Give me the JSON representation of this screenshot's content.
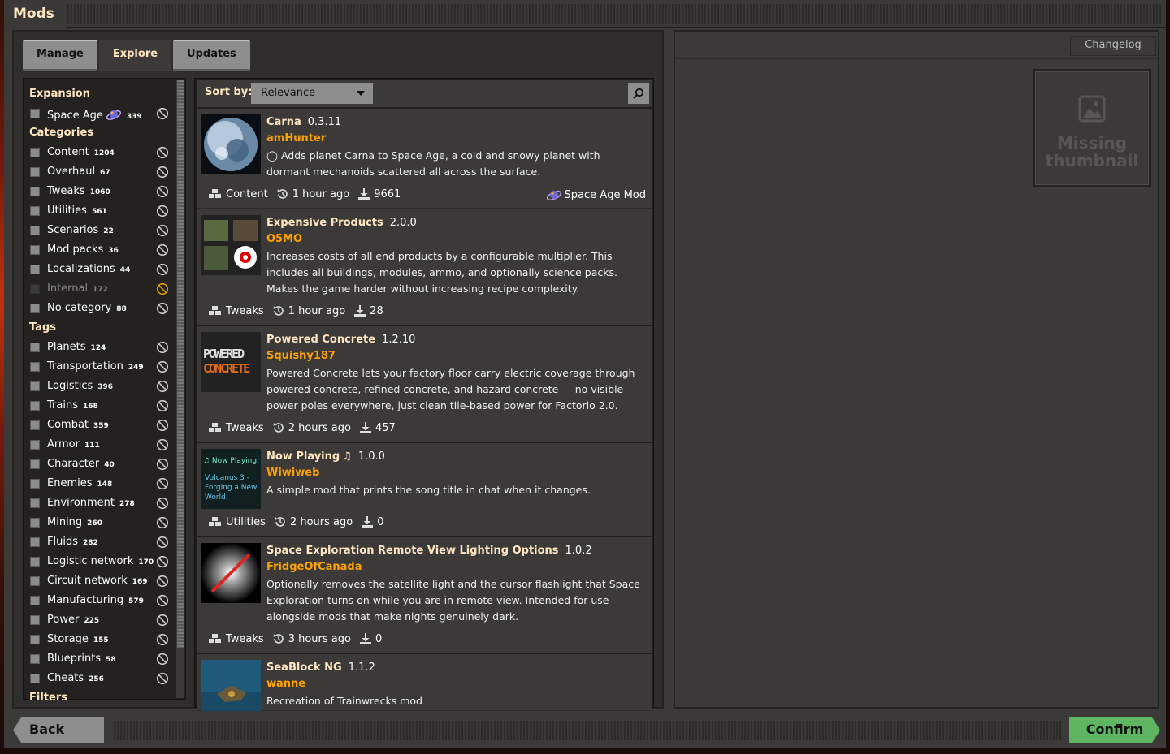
{
  "window": {
    "title": "Mods"
  },
  "tabs": [
    {
      "label": "Manage"
    },
    {
      "label": "Explore"
    },
    {
      "label": "Updates"
    }
  ],
  "filters": {
    "expansion_heading": "Expansion",
    "expansion": [
      {
        "label": "Space Age",
        "count": "339"
      }
    ],
    "categories_heading": "Categories",
    "categories": [
      {
        "label": "Content",
        "count": "1204"
      },
      {
        "label": "Overhaul",
        "count": "67"
      },
      {
        "label": "Tweaks",
        "count": "1060"
      },
      {
        "label": "Utilities",
        "count": "561"
      },
      {
        "label": "Scenarios",
        "count": "22"
      },
      {
        "label": "Mod packs",
        "count": "36"
      },
      {
        "label": "Localizations",
        "count": "44"
      },
      {
        "label": "Internal",
        "count": "172"
      },
      {
        "label": "No category",
        "count": "88"
      }
    ],
    "tags_heading": "Tags",
    "tags": [
      {
        "label": "Planets",
        "count": "124"
      },
      {
        "label": "Transportation",
        "count": "249"
      },
      {
        "label": "Logistics",
        "count": "396"
      },
      {
        "label": "Trains",
        "count": "168"
      },
      {
        "label": "Combat",
        "count": "359"
      },
      {
        "label": "Armor",
        "count": "111"
      },
      {
        "label": "Character",
        "count": "40"
      },
      {
        "label": "Enemies",
        "count": "148"
      },
      {
        "label": "Environment",
        "count": "278"
      },
      {
        "label": "Mining",
        "count": "260"
      },
      {
        "label": "Fluids",
        "count": "282"
      },
      {
        "label": "Logistic network",
        "count": "170"
      },
      {
        "label": "Circuit network",
        "count": "169"
      },
      {
        "label": "Manufacturing",
        "count": "579"
      },
      {
        "label": "Power",
        "count": "225"
      },
      {
        "label": "Storage",
        "count": "155"
      },
      {
        "label": "Blueprints",
        "count": "58"
      },
      {
        "label": "Cheats",
        "count": "256"
      }
    ],
    "filters_heading": "Filters"
  },
  "sort": {
    "label": "Sort by:",
    "value": "Relevance"
  },
  "mods": [
    {
      "name": "Carna",
      "version": "0.3.11",
      "author": "amHunter",
      "desc": "◯ Adds planet Carna to Space Age, a cold and snowy planet with dormant mechanoids scattered all across the surface.",
      "category": "Content",
      "time": "1 hour ago",
      "downloads": "9661",
      "badge": "Space Age Mod"
    },
    {
      "name": "Expensive Products",
      "version": "2.0.0",
      "author": "O5MO",
      "desc": "Increases costs of all end products by a configurable multiplier. This includes all buildings, modules, ammo, and optionally science packs.\nMakes the game harder without increasing recipe complexity.",
      "category": "Tweaks",
      "time": "1 hour ago",
      "downloads": "28"
    },
    {
      "name": "Powered Concrete",
      "version": "1.2.10",
      "author": "Squishy187",
      "desc": "Powered Concrete lets your factory floor carry electric coverage through powered concrete, refined concrete, and hazard concrete — no visible power poles everywhere, just clean tile-based power for Factorio 2.0.",
      "category": "Tweaks",
      "time": "2 hours ago",
      "downloads": "457",
      "thumb_text": [
        "POWERED",
        "CONCRETE"
      ]
    },
    {
      "name": "Now Playing",
      "version": "1.0.0",
      "author": "Wiwiweb",
      "desc": "A simple mod that prints the song title in chat when it changes.",
      "category": "Utilities",
      "time": "2 hours ago",
      "downloads": "0",
      "thumb_text": [
        "♫ Now Playing:",
        "Vulcanus 3 - Forging a New World"
      ]
    },
    {
      "name": "Space Exploration Remote View Lighting Options",
      "version": "1.0.2",
      "author": "FridgeOfCanada",
      "desc": "Optionally removes the satellite light and the cursor flashlight that Space Exploration turns on while you are in remote view. Intended for use alongside mods that make nights genuinely dark.",
      "category": "Tweaks",
      "time": "3 hours ago",
      "downloads": "0"
    },
    {
      "name": "SeaBlock NG",
      "version": "1.1.2",
      "author": "wanne",
      "desc": "Recreation of Trainwrecks mod"
    }
  ],
  "right": {
    "changelog_label": "Changelog",
    "missing_thumb": "Missing thumbnail"
  },
  "footer": {
    "back_label": "Back",
    "confirm_label": "Confirm"
  },
  "colors": {
    "accent_title": "#ffe6c0",
    "author": "#ffa200",
    "confirm": "#5eb663",
    "button": "#8e8e8e"
  }
}
